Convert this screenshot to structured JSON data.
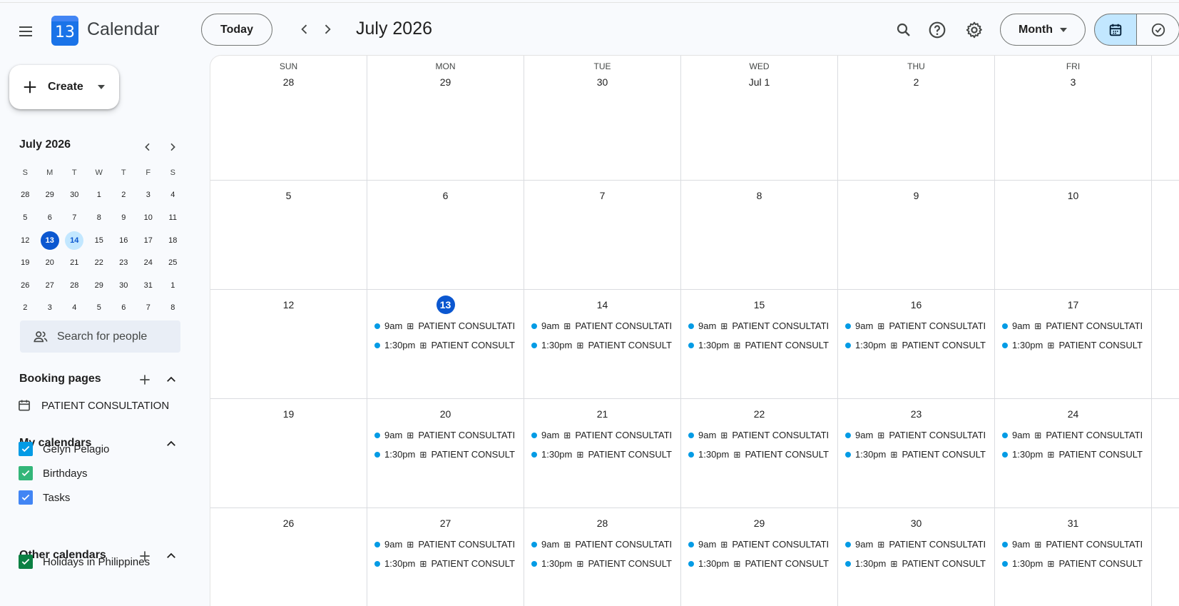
{
  "header": {
    "app_title": "Calendar",
    "logo_day": "13",
    "today_label": "Today",
    "current_period": "July 2026",
    "view_label": "Month"
  },
  "sidebar": {
    "create_label": "Create",
    "mini_calendar": {
      "title": "July 2026",
      "weekdays": [
        "S",
        "M",
        "T",
        "W",
        "T",
        "F",
        "S"
      ],
      "weeks": [
        [
          "28",
          "29",
          "30",
          "1",
          "2",
          "3",
          "4"
        ],
        [
          "5",
          "6",
          "7",
          "8",
          "9",
          "10",
          "11"
        ],
        [
          "12",
          "13",
          "14",
          "15",
          "16",
          "17",
          "18"
        ],
        [
          "19",
          "20",
          "21",
          "22",
          "23",
          "24",
          "25"
        ],
        [
          "26",
          "27",
          "28",
          "29",
          "30",
          "31",
          "1"
        ],
        [
          "2",
          "3",
          "4",
          "5",
          "6",
          "7",
          "8"
        ]
      ],
      "selected_day": "13",
      "highlighted_day": "14"
    },
    "search_people_placeholder": "Search for people",
    "booking_pages": {
      "title": "Booking pages",
      "items": [
        "PATIENT CONSULTATION"
      ]
    },
    "my_calendars": {
      "title": "My calendars",
      "items": [
        {
          "label": "Gelyn Pelagio",
          "color": "#039be5"
        },
        {
          "label": "Birthdays",
          "color": "#33b679"
        },
        {
          "label": "Tasks",
          "color": "#4285f4"
        }
      ]
    },
    "other_calendars": {
      "title": "Other calendars",
      "items": [
        {
          "label": "Holidays in Philippines",
          "color": "#0b8043"
        }
      ]
    }
  },
  "month_grid": {
    "weekdays": [
      "SUN",
      "MON",
      "TUE",
      "WED",
      "THU",
      "FRI"
    ],
    "today": "13",
    "event_color": "#039be5",
    "weeks": [
      [
        {
          "date": "28",
          "events": []
        },
        {
          "date": "29",
          "events": []
        },
        {
          "date": "30",
          "events": []
        },
        {
          "date": "Jul 1",
          "events": []
        },
        {
          "date": "2",
          "events": []
        },
        {
          "date": "3",
          "events": []
        }
      ],
      [
        {
          "date": "5",
          "events": []
        },
        {
          "date": "6",
          "events": []
        },
        {
          "date": "7",
          "events": []
        },
        {
          "date": "8",
          "events": []
        },
        {
          "date": "9",
          "events": []
        },
        {
          "date": "10",
          "events": []
        }
      ],
      [
        {
          "date": "12",
          "events": []
        },
        {
          "date": "13",
          "events": [
            {
              "time": "9am",
              "title": "PATIENT CONSULTATI"
            },
            {
              "time": "1:30pm",
              "title": "PATIENT CONSULT"
            }
          ]
        },
        {
          "date": "14",
          "events": [
            {
              "time": "9am",
              "title": "PATIENT CONSULTATI"
            },
            {
              "time": "1:30pm",
              "title": "PATIENT CONSULT"
            }
          ]
        },
        {
          "date": "15",
          "events": [
            {
              "time": "9am",
              "title": "PATIENT CONSULTATI"
            },
            {
              "time": "1:30pm",
              "title": "PATIENT CONSULT"
            }
          ]
        },
        {
          "date": "16",
          "events": [
            {
              "time": "9am",
              "title": "PATIENT CONSULTATI"
            },
            {
              "time": "1:30pm",
              "title": "PATIENT CONSULT"
            }
          ]
        },
        {
          "date": "17",
          "events": [
            {
              "time": "9am",
              "title": "PATIENT CONSULTATI"
            },
            {
              "time": "1:30pm",
              "title": "PATIENT CONSULT"
            }
          ]
        }
      ],
      [
        {
          "date": "19",
          "events": []
        },
        {
          "date": "20",
          "events": [
            {
              "time": "9am",
              "title": "PATIENT CONSULTATI"
            },
            {
              "time": "1:30pm",
              "title": "PATIENT CONSULT"
            }
          ]
        },
        {
          "date": "21",
          "events": [
            {
              "time": "9am",
              "title": "PATIENT CONSULTATI"
            },
            {
              "time": "1:30pm",
              "title": "PATIENT CONSULT"
            }
          ]
        },
        {
          "date": "22",
          "events": [
            {
              "time": "9am",
              "title": "PATIENT CONSULTATI"
            },
            {
              "time": "1:30pm",
              "title": "PATIENT CONSULT"
            }
          ]
        },
        {
          "date": "23",
          "events": [
            {
              "time": "9am",
              "title": "PATIENT CONSULTATI"
            },
            {
              "time": "1:30pm",
              "title": "PATIENT CONSULT"
            }
          ]
        },
        {
          "date": "24",
          "events": [
            {
              "time": "9am",
              "title": "PATIENT CONSULTATI"
            },
            {
              "time": "1:30pm",
              "title": "PATIENT CONSULT"
            }
          ]
        }
      ],
      [
        {
          "date": "26",
          "events": []
        },
        {
          "date": "27",
          "events": [
            {
              "time": "9am",
              "title": "PATIENT CONSULTATI"
            },
            {
              "time": "1:30pm",
              "title": "PATIENT CONSULT"
            }
          ]
        },
        {
          "date": "28",
          "events": [
            {
              "time": "9am",
              "title": "PATIENT CONSULTATI"
            },
            {
              "time": "1:30pm",
              "title": "PATIENT CONSULT"
            }
          ]
        },
        {
          "date": "29",
          "events": [
            {
              "time": "9am",
              "title": "PATIENT CONSULTATI"
            },
            {
              "time": "1:30pm",
              "title": "PATIENT CONSULT"
            }
          ]
        },
        {
          "date": "30",
          "events": [
            {
              "time": "9am",
              "title": "PATIENT CONSULTATI"
            },
            {
              "time": "1:30pm",
              "title": "PATIENT CONSULT"
            }
          ]
        },
        {
          "date": "31",
          "events": [
            {
              "time": "9am",
              "title": "PATIENT CONSULTATI"
            },
            {
              "time": "1:30pm",
              "title": "PATIENT CONSULT"
            }
          ]
        }
      ]
    ]
  }
}
